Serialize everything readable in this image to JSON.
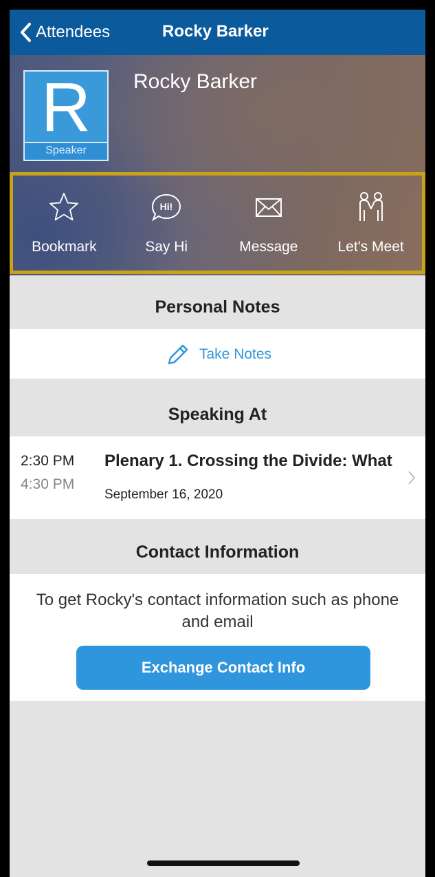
{
  "nav": {
    "back_label": "Attendees",
    "title": "Rocky Barker"
  },
  "profile": {
    "initial": "R",
    "badge": "Speaker",
    "name": "Rocky Barker"
  },
  "actions": [
    {
      "label": "Bookmark",
      "icon": "star-icon"
    },
    {
      "label": "Say Hi",
      "icon": "hi-bubble-icon",
      "icon_text": "Hi!"
    },
    {
      "label": "Message",
      "icon": "envelope-icon"
    },
    {
      "label": "Let's Meet",
      "icon": "people-handshake-icon"
    }
  ],
  "personal_notes": {
    "header": "Personal Notes",
    "button_label": "Take Notes"
  },
  "speaking_at": {
    "header": "Speaking At",
    "sessions": [
      {
        "start": "2:30 PM",
        "end": "4:30 PM",
        "title": "Plenary 1. Crossing the Divide: What",
        "date": "September 16, 2020"
      }
    ]
  },
  "contact": {
    "header": "Contact Information",
    "description": "To get Rocky's contact information such as phone and email",
    "button_label": "Exchange Contact Info"
  },
  "colors": {
    "nav_background": "#0a5a9c",
    "accent": "#2f95dc",
    "highlight_border": "#c8a319",
    "avatar": "#3a9ad9"
  }
}
